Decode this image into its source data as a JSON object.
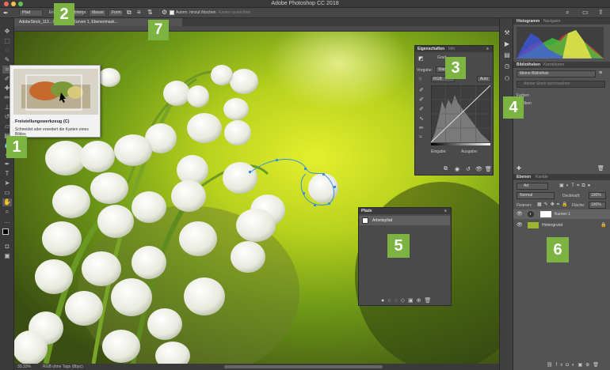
{
  "app": {
    "title": "Adobe Photoshop CC 2018"
  },
  "options": {
    "tool_mode": "Pfad",
    "tool_btn2": "Masse",
    "tool_btn3": "Form",
    "auto_label": "Autom. hinzuf./löschen",
    "edge_label": "Kanten ausrichten",
    "ext2": "Interpr."
  },
  "document": {
    "tab": "AdobeStock_113... bei 33,3% (Kurven 1, Ebenenmask..."
  },
  "status": {
    "zoom": "33,33%",
    "info": "RGB ohne Tags (8bpc)"
  },
  "tooltip": {
    "title": "Freistellungswerkzeug (C)",
    "desc": "Schneidet oder erweitert die Kanten eines Bildes"
  },
  "properties": {
    "tab1": "Eigenschaften",
    "tab2": "Info",
    "kind": "Grad",
    "preset_label": "Vorgabe:",
    "preset_value": "Stan",
    "channel": "RGB",
    "auto": "Auto",
    "input_label": "Eingabe:",
    "output_label": "Ausgabe:"
  },
  "paths": {
    "title": "Pfade",
    "item": "Arbeitspfad"
  },
  "histogram": {
    "tab1": "Histogramm",
    "tab2": "Navigator"
  },
  "libraries": {
    "tab1": "Bibliotheken",
    "tab2": "Korrekturen",
    "select": "Meine Bibliothek",
    "search": "Adobe Stock durchsuchen",
    "item1": "Farben",
    "item2": "Grafiken"
  },
  "layers": {
    "tab1": "Ebenen",
    "tab2": "Kanäle",
    "filter": "Art",
    "blend": "Normal",
    "opacity_label": "Deckkraft:",
    "opacity": "100%",
    "lock_label": "Fixieren:",
    "fill_label": "Fläche:",
    "fill": "100%",
    "layer1": "Kurven 1",
    "layer2": "Hintergrund"
  },
  "badges": [
    "1",
    "2",
    "3",
    "4",
    "5",
    "6",
    "7"
  ],
  "colors": {
    "accent": "#7cb342",
    "panel": "#4a4a4a"
  }
}
